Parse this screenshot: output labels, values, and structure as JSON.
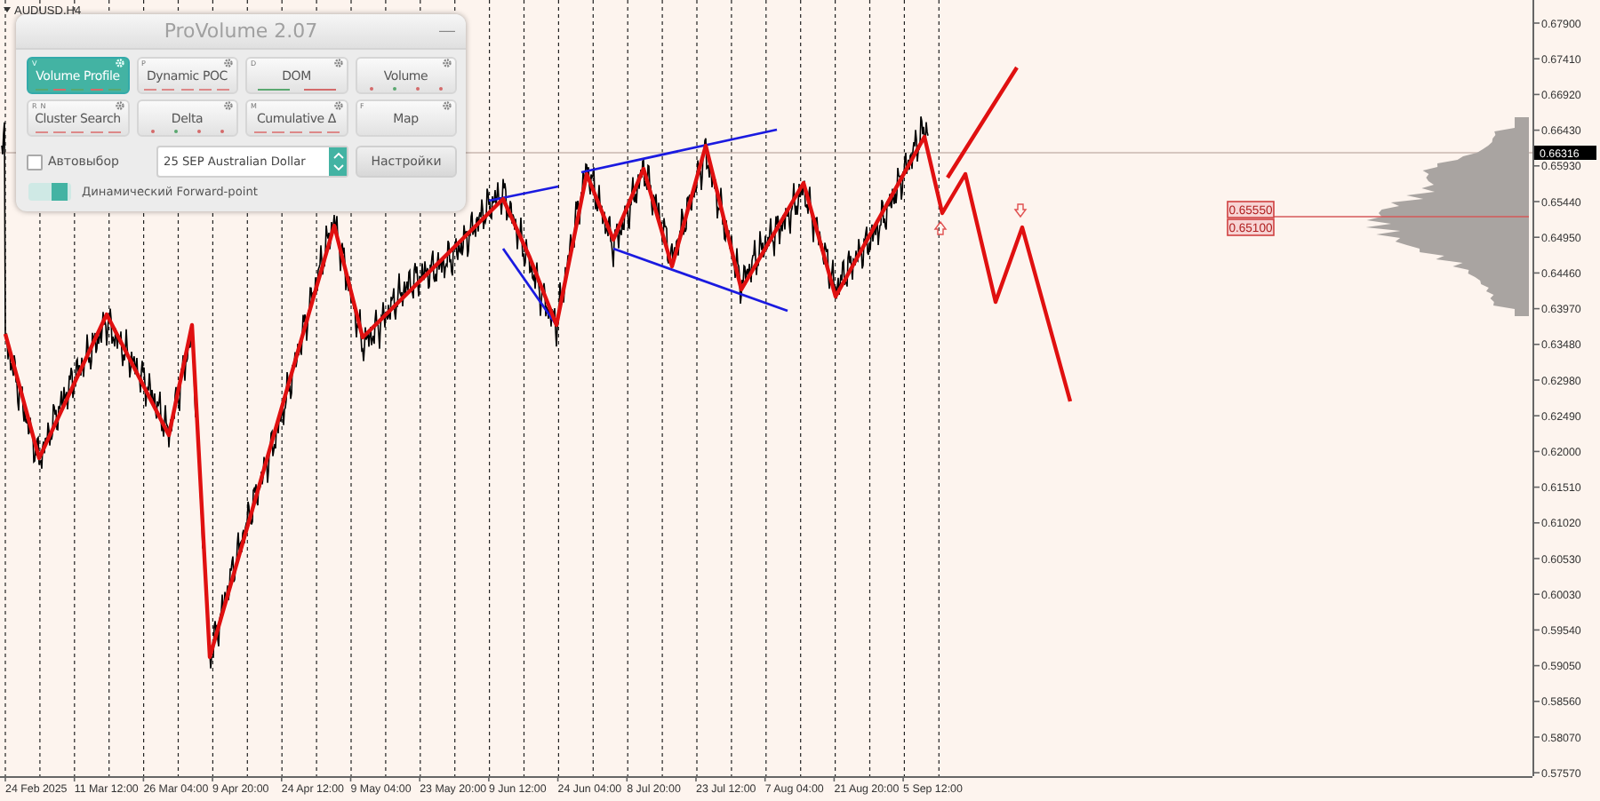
{
  "chart": {
    "symbol": "AUDUSD,H4",
    "price_axis": [
      "0.67900",
      "0.67410",
      "0.66920",
      "0.66430",
      "0.65930",
      "0.65440",
      "0.64950",
      "0.64460",
      "0.63970",
      "0.63480",
      "0.62980",
      "0.62490",
      "0.62000",
      "0.61510",
      "0.61020",
      "0.60530",
      "0.60030",
      "0.59540",
      "0.59050",
      "0.58560",
      "0.58070",
      "0.57570"
    ],
    "current_price": "0.66316",
    "time_axis": [
      "24 Feb 2025",
      "11 Mar 12:00",
      "26 Mar 04:00",
      "9 Apr 20:00",
      "24 Apr 12:00",
      "9 May 04:00",
      "23 May 20:00",
      "9 Jun 12:00",
      "24 Jun 04:00",
      "8 Jul 20:00",
      "23 Jul 12:00",
      "7 Aug 04:00",
      "21 Aug 20:00",
      "5 Sep 12:00"
    ],
    "levels": [
      {
        "label": "0.65550"
      },
      {
        "label": "0.65100"
      }
    ]
  },
  "panel": {
    "title": "ProVolume 2.07",
    "minimize": "—",
    "modes": [
      {
        "label": "Volume Profile",
        "hotkeys": [
          "V"
        ],
        "selected": true,
        "kind": "dashes"
      },
      {
        "label": "Dynamic POC",
        "hotkeys": [
          "P"
        ],
        "selected": false,
        "kind": "dashes"
      },
      {
        "label": "DOM",
        "hotkeys": [
          "D"
        ],
        "selected": false,
        "kind": "lines"
      },
      {
        "label": "Volume",
        "selected": false,
        "kind": "dots"
      },
      {
        "label": "Cluster Search",
        "hotkeys": [
          "R",
          "N"
        ],
        "selected": false,
        "kind": "dashes"
      },
      {
        "label": "Delta",
        "selected": false,
        "kind": "dots"
      },
      {
        "label": "Cumulative Δ",
        "hotkeys": [
          "M"
        ],
        "selected": false,
        "kind": "dashes"
      },
      {
        "label": "Map",
        "hotkeys": [
          "F"
        ],
        "selected": false,
        "kind": "plain"
      }
    ],
    "auto_select": {
      "label": "Автовыбор",
      "checked": false
    },
    "instrument": {
      "value": "25 SEP Australian Dollar"
    },
    "settings_button": "Настройки",
    "forward_point": {
      "label": "Динамический Forward-point",
      "on": true
    }
  }
}
